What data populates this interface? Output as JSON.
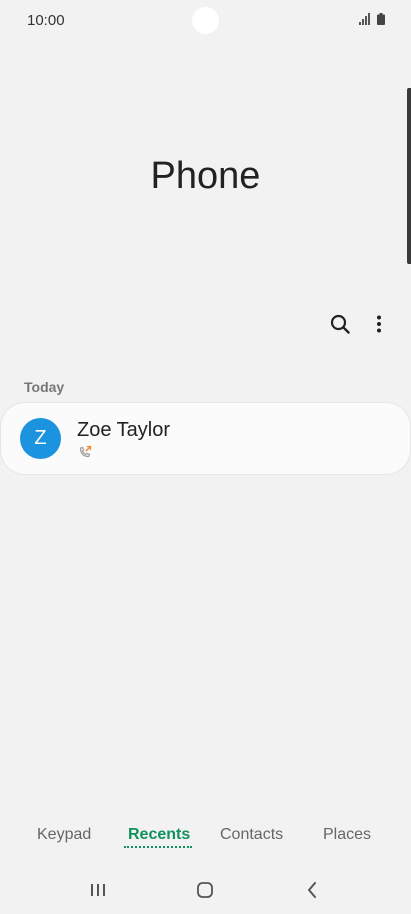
{
  "status_bar": {
    "time": "10:00",
    "icons": [
      "signal-icon",
      "battery-icon"
    ]
  },
  "header": {
    "title": "Phone"
  },
  "toolbar": {
    "icons": [
      "search-icon",
      "more-options-icon"
    ]
  },
  "recents": {
    "section_label": "Today",
    "items": [
      {
        "initial": "Z",
        "name": "Zoe Taylor",
        "call_icon": "outgoing-call-icon",
        "avatar_color": "#1b93de"
      }
    ]
  },
  "tabs": [
    {
      "label": "Keypad",
      "active": false
    },
    {
      "label": "Recents",
      "active": true
    },
    {
      "label": "Contacts",
      "active": false
    },
    {
      "label": "Places",
      "active": false
    }
  ],
  "nav": {
    "icons": [
      "recent-apps-icon",
      "home-icon",
      "back-icon"
    ]
  },
  "colors": {
    "accent": "#11915c",
    "background": "#f2f2f2",
    "avatar": "#1b93de",
    "outgoing": "#f08a2a"
  }
}
